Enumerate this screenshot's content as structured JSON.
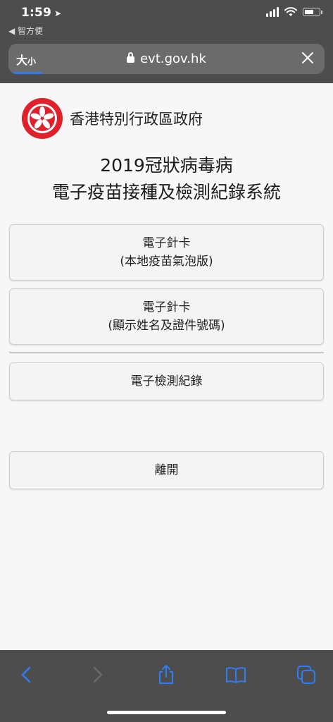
{
  "status_bar": {
    "time": "1:59",
    "back_app": "◀ 智方便"
  },
  "browser": {
    "text_size_label_big": "大",
    "text_size_label_small": "小",
    "url": "evt.gov.hk",
    "accent": "#2f7df6"
  },
  "header": {
    "gov_name": "香港特別行政區政府",
    "title_line1": "2019冠狀病毒病",
    "title_line2": "電子疫苗接種及檢測紀錄系統"
  },
  "buttons": [
    {
      "line1": "電子針卡",
      "line2": "(本地疫苗氣泡版)"
    },
    {
      "line1": "電子針卡",
      "line2": "(顯示姓名及證件號碼)"
    },
    {
      "line1": "電子檢測紀錄"
    },
    {
      "line1": "離開"
    }
  ],
  "toolbar": {
    "icons": [
      "back-icon",
      "forward-icon",
      "share-icon",
      "bookmarks-icon",
      "tabs-icon"
    ],
    "icon_color": "#2f7df6"
  },
  "emblem": {
    "color": "#e0202a"
  }
}
